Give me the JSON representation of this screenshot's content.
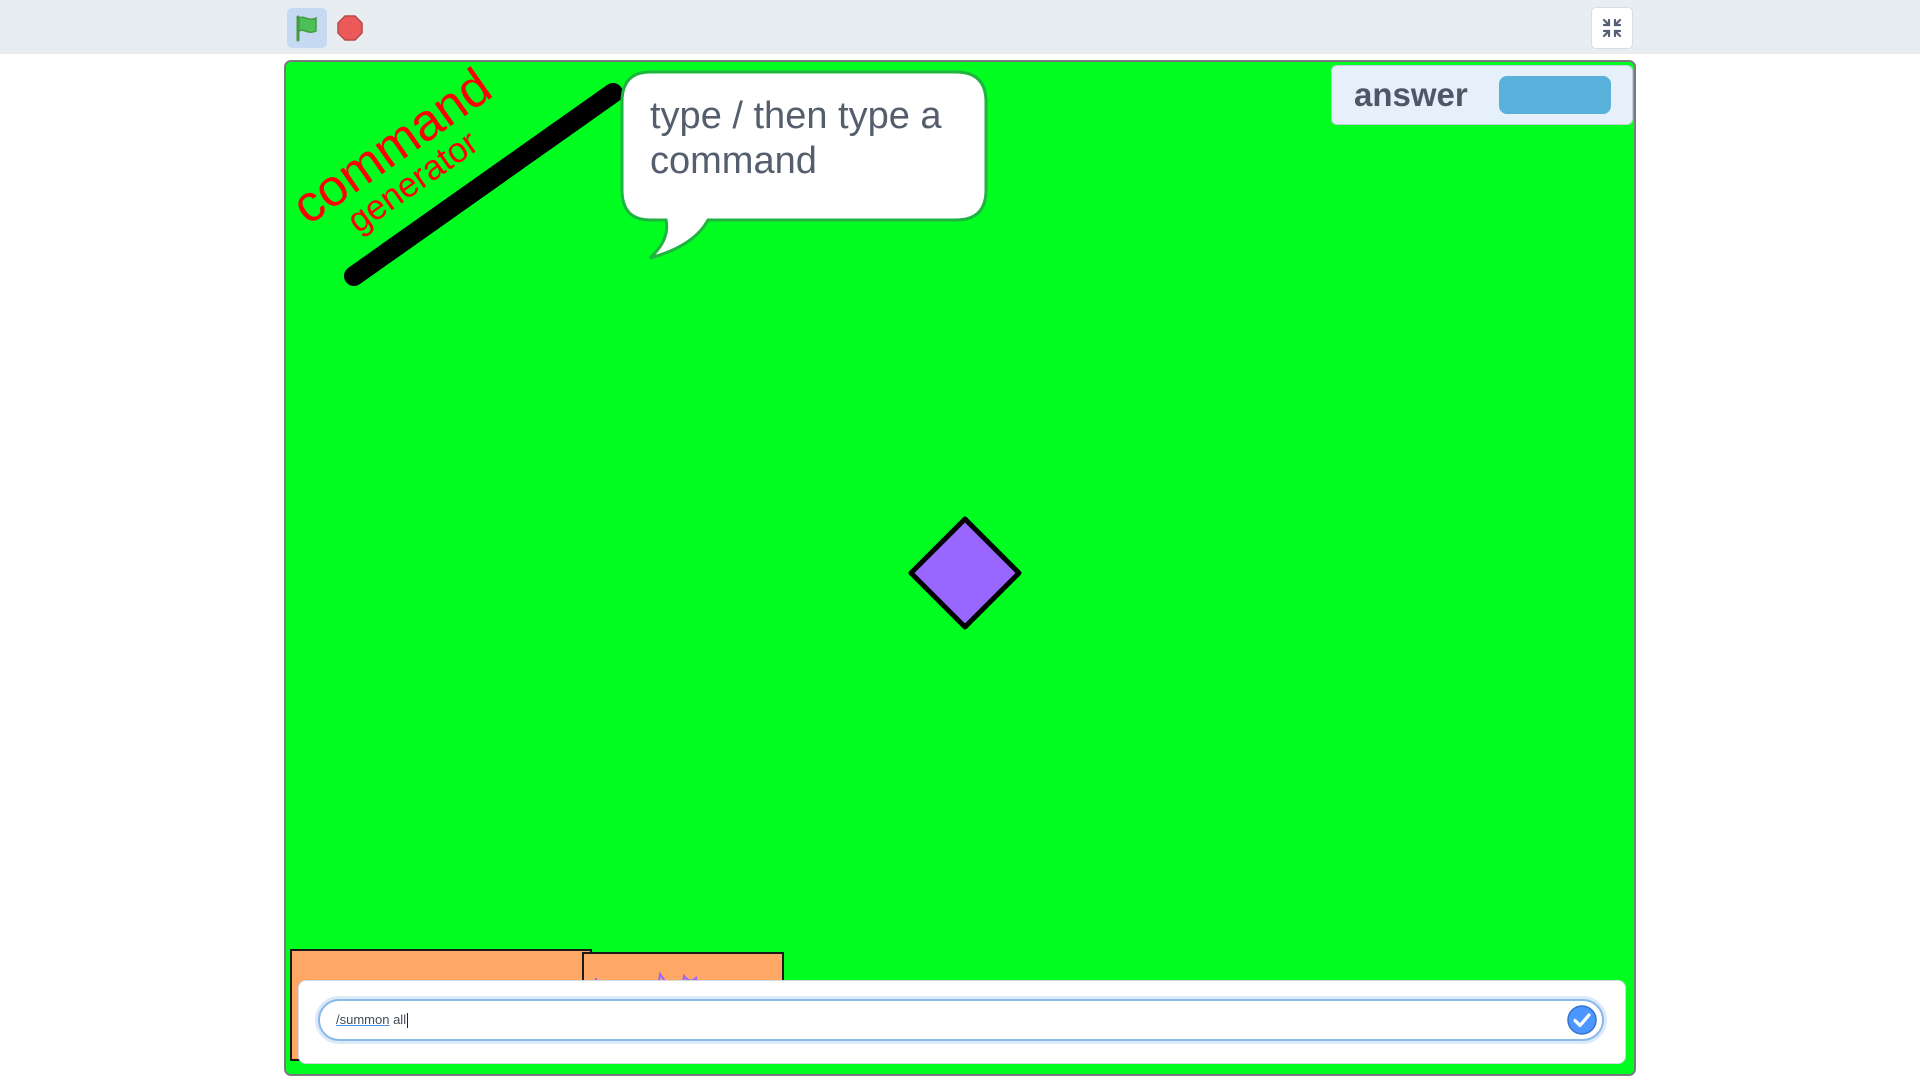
{
  "toolbar": {
    "green_flag": "green-flag-icon",
    "stop": "stop-icon",
    "fullscreen_toggle": "unfullscreen-icon"
  },
  "stage": {
    "background_color": "#00ff20",
    "title_line1": "command",
    "title_line2": "generator",
    "speech_bubble": "type / then type a command",
    "variable_monitor": {
      "label": "answer",
      "value": ""
    },
    "ask_prompt": {
      "command": "/summon",
      "rest": " all"
    }
  },
  "colors": {
    "accent": "#4c97ff",
    "title_red": "#ff0000",
    "monitor_value": "#59b0da",
    "sprite_purple": "#9966ff",
    "orange_sprite": "#ffa866"
  }
}
